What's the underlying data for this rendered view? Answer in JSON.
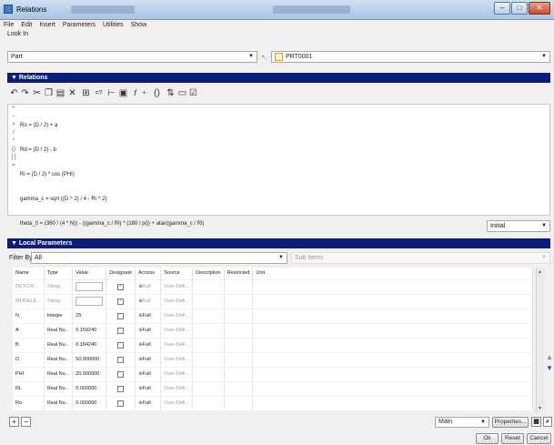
{
  "window": {
    "title": "Relations"
  },
  "menu": [
    "File",
    "Edit",
    "Insert",
    "Parameters",
    "Utilities",
    "Show"
  ],
  "lookin": {
    "label": "Look In",
    "scope": "Part",
    "model": "PRT0001"
  },
  "relations": {
    "header": "Relations",
    "gutter": [
      "+",
      "−",
      "×",
      "/",
      "^",
      "()",
      "[ ]",
      "="
    ],
    "lines": [
      "Ro = (D / 2) + a",
      "Rd = (D / 2) - b",
      "Ri = (D / 2) * cos (PHI)",
      "gamma_c = sqrt ((D ^ 2) / 4 - Ri ^ 2)",
      "theta_0 = (360 / (4 * N)) - ((gamma_c / Ri) * (180 / pi)) + atan(gamma_c / Ri)"
    ],
    "units": "Initial"
  },
  "local": {
    "header": "Local Parameters",
    "filter_label": "Filter By",
    "filter_value": "All",
    "sub_items": "Sub Items",
    "columns": [
      "Name",
      "Type",
      "Value",
      "Designate",
      "Access",
      "Source",
      "Description",
      "Restricted",
      "Unit"
    ],
    "rows": [
      {
        "name": "DESCRI...",
        "type": "String",
        "value": "",
        "designate": true,
        "access": "Full",
        "source": "User-Defi...",
        "gray": true
      },
      {
        "name": "MODELE...",
        "type": "String",
        "value": "",
        "designate": true,
        "access": "Full",
        "source": "User-Defi...",
        "gray": true
      },
      {
        "name": "N",
        "type": "Integer",
        "value": "25",
        "designate": false,
        "access": "Full",
        "source": "User-Defi...",
        "gray": false
      },
      {
        "name": "A",
        "type": "Real Nu...",
        "value": "0.159240",
        "designate": false,
        "access": "Full",
        "source": "User-Defi...",
        "gray": false
      },
      {
        "name": "B",
        "type": "Real Nu...",
        "value": "0.184240",
        "designate": false,
        "access": "Full",
        "source": "User-Defi...",
        "gray": false
      },
      {
        "name": "D",
        "type": "Real Nu...",
        "value": "50.000000",
        "designate": false,
        "access": "Full",
        "source": "User-Defi...",
        "gray": false
      },
      {
        "name": "PHI",
        "type": "Real Nu...",
        "value": "20.000000",
        "designate": false,
        "access": "Full",
        "source": "User-Defi...",
        "gray": false
      },
      {
        "name": "RL",
        "type": "Real Nu...",
        "value": "0.000000",
        "designate": false,
        "access": "Full",
        "source": "User-Defi...",
        "gray": false
      },
      {
        "name": "Ro",
        "type": "Real Nu...",
        "value": "0.000000",
        "designate": false,
        "access": "Full",
        "source": "User-Defi...",
        "gray": false
      }
    ]
  },
  "bottom": {
    "view": "Main",
    "properties": "Properties...",
    "ok": "Ok",
    "reset": "Reset",
    "cancel": "Cancel"
  }
}
